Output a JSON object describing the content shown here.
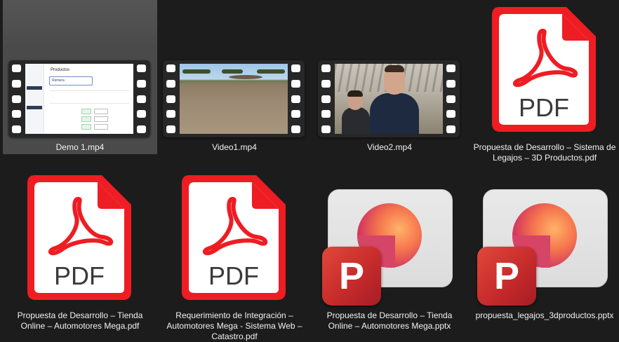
{
  "files": [
    {
      "name": "Demo 1.mp4",
      "kind": "video",
      "selected": true
    },
    {
      "name": "Video1.mp4",
      "kind": "video"
    },
    {
      "name": "Video2.mp4",
      "kind": "video"
    },
    {
      "name": "Propuesta de Desarrollo – Sistema de Legajos – 3D Productos.pdf",
      "kind": "pdf"
    },
    {
      "name": "Propuesta de Desarrollo – Tienda Online – Automotores Mega.pdf",
      "kind": "pdf"
    },
    {
      "name": "Requerimiento de Integración – Automotores Mega - Sistema Web – Catastro.pdf",
      "kind": "pdf"
    },
    {
      "name": "Propuesta de Desarrollo – Tienda Online – Automotores Mega.pptx",
      "kind": "pptx"
    },
    {
      "name": "propuesta_legajos_3dproductos.pptx",
      "kind": "pptx"
    }
  ],
  "demo_preview": {
    "title": "Productos",
    "field_text": "Remera"
  },
  "icons": {
    "pdf_label": "PDF",
    "pptx_letter": "P"
  },
  "colors": {
    "background": "#1c1c1c",
    "selection": "#4a4a4a",
    "pdf_red": "#ee1d23",
    "ppt_red": "#c72b2b"
  }
}
